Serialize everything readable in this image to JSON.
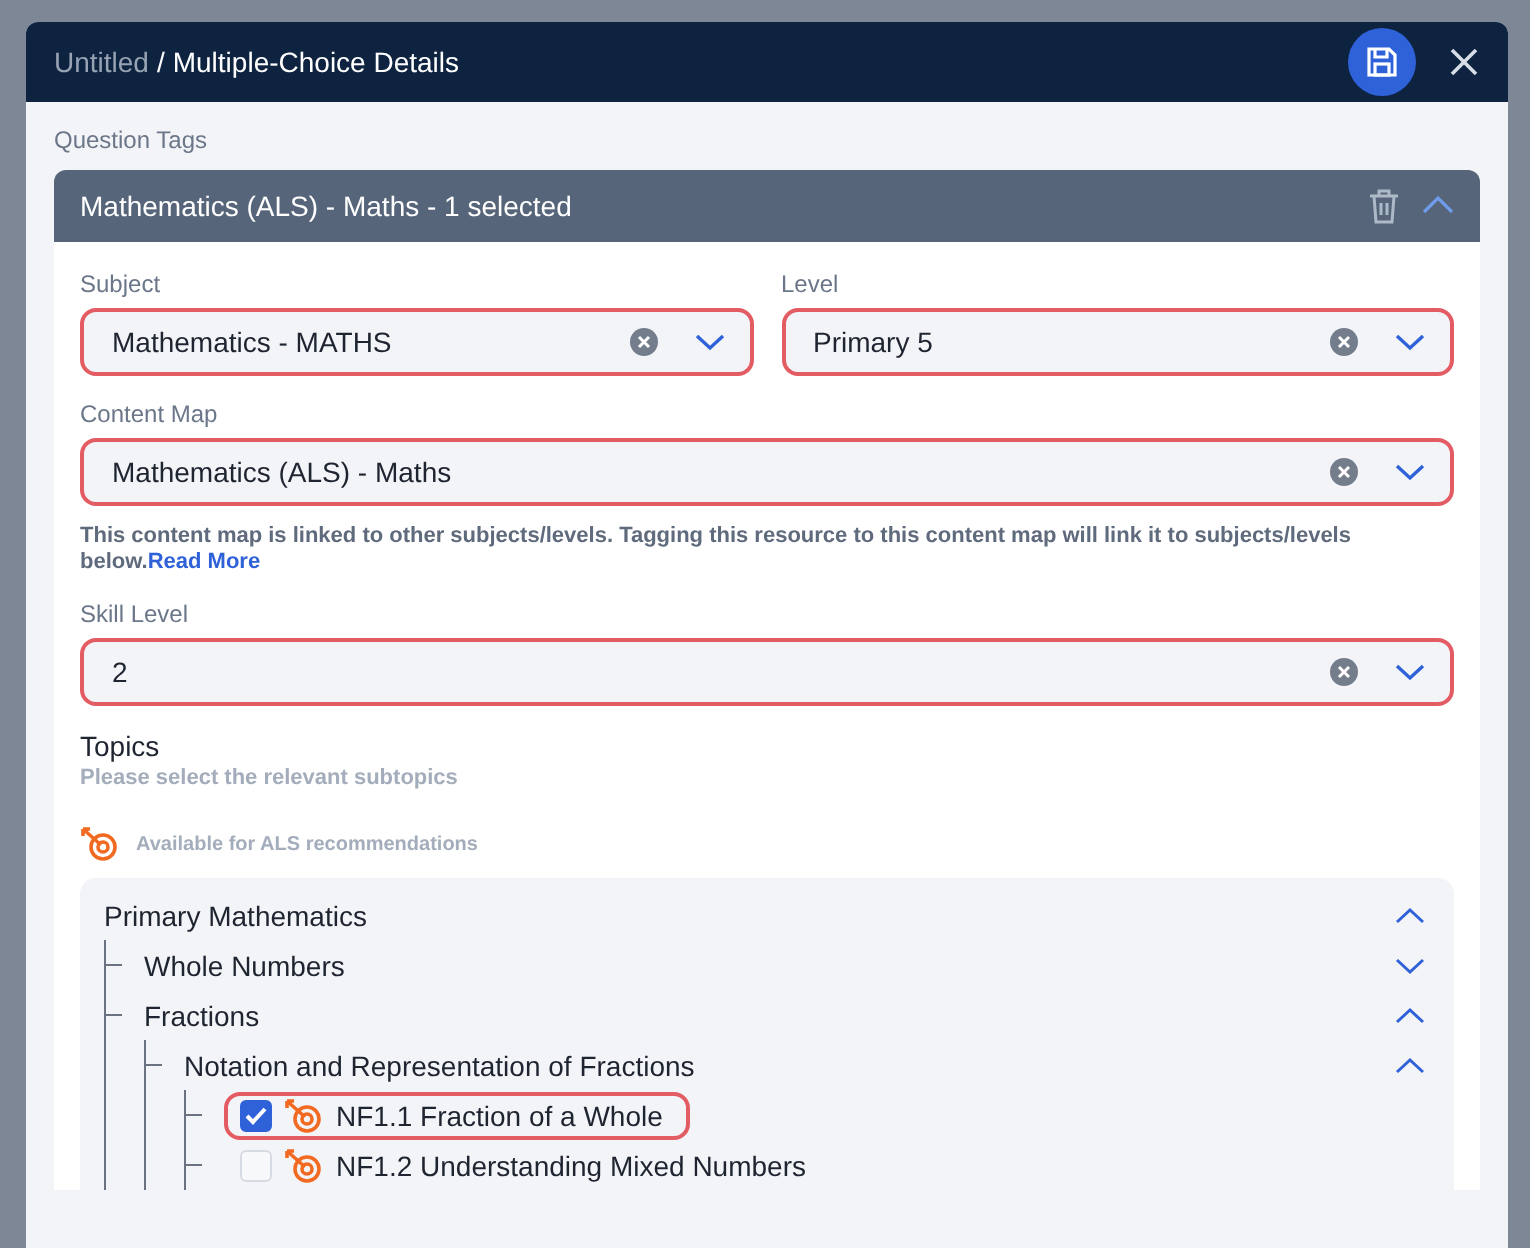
{
  "window": {
    "breadcrumb_parent": "Untitled",
    "separator": "/",
    "title": "Multiple-Choice Details"
  },
  "section_label": "Question Tags",
  "tag_group": {
    "title": "Mathematics (ALS) - Maths - 1 selected",
    "expanded": true,
    "field_rows": [
      [
        {
          "label": "Subject",
          "value": "Mathematics - MATHS",
          "highlighted": true
        },
        {
          "label": "Level",
          "value": "Primary 5",
          "highlighted": true
        }
      ],
      [
        {
          "label": "Content Map",
          "value": "Mathematics (ALS) - Maths",
          "highlighted": true,
          "note": "This content map is linked to other subjects/levels. Tagging this resource to this content map will link it to subjects/levels below.",
          "note_link": "Read More"
        }
      ],
      [
        {
          "label": "Skill Level",
          "value": "2",
          "highlighted": true
        }
      ]
    ],
    "topics": {
      "title": "Topics",
      "hint": "Please select the relevant subtopics",
      "legend": "Available for ALS recommendations",
      "tree": [
        {
          "kind": "branch",
          "label": "Primary Mathematics",
          "expanded": true,
          "children": [
            {
              "kind": "branch",
              "label": "Whole Numbers",
              "expanded": false
            },
            {
              "kind": "branch",
              "label": "Fractions",
              "expanded": true,
              "children": [
                {
                  "kind": "branch",
                  "label": "Notation and Representation of Fractions",
                  "expanded": true,
                  "children": [
                    {
                      "kind": "leaf",
                      "label": "NF1.1 Fraction of a Whole",
                      "checked": true,
                      "als": true,
                      "highlighted": true
                    },
                    {
                      "kind": "leaf",
                      "label": "NF1.2 Understanding Mixed Numbers",
                      "checked": false,
                      "als": true,
                      "highlighted": false
                    }
                  ]
                }
              ]
            }
          ]
        }
      ]
    }
  }
}
